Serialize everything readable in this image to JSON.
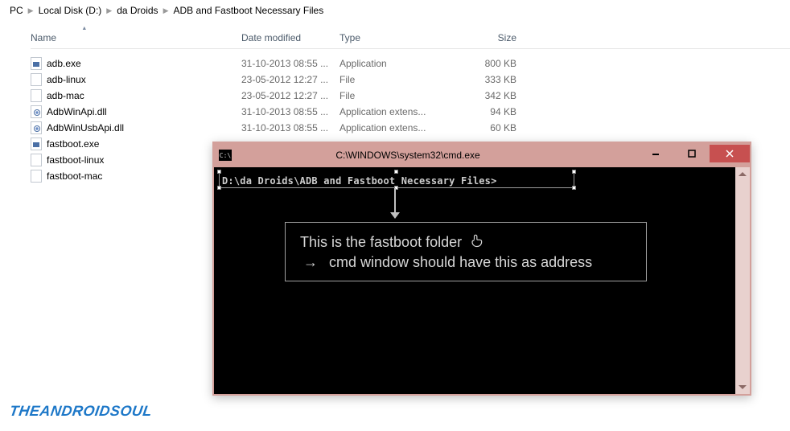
{
  "breadcrumb": {
    "segments": [
      "PC",
      "Local Disk (D:)",
      "da Droids",
      "ADB and Fastboot Necessary Files"
    ]
  },
  "columns": {
    "name": "Name",
    "date": "Date modified",
    "type": "Type",
    "size": "Size"
  },
  "files": [
    {
      "name": "adb.exe",
      "date": "31-10-2013 08:55 ...",
      "type": "Application",
      "size": "800 KB",
      "kind": "exe"
    },
    {
      "name": "adb-linux",
      "date": "23-05-2012 12:27 ...",
      "type": "File",
      "size": "333 KB",
      "kind": "plain"
    },
    {
      "name": "adb-mac",
      "date": "23-05-2012 12:27 ...",
      "type": "File",
      "size": "342 KB",
      "kind": "plain"
    },
    {
      "name": "AdbWinApi.dll",
      "date": "31-10-2013 08:55 ...",
      "type": "Application extens...",
      "size": "94 KB",
      "kind": "dll"
    },
    {
      "name": "AdbWinUsbApi.dll",
      "date": "31-10-2013 08:55 ...",
      "type": "Application extens...",
      "size": "60 KB",
      "kind": "dll"
    },
    {
      "name": "fastboot.exe",
      "date": "",
      "type": "",
      "size": "",
      "kind": "exe"
    },
    {
      "name": "fastboot-linux",
      "date": "",
      "type": "",
      "size": "",
      "kind": "plain"
    },
    {
      "name": "fastboot-mac",
      "date": "",
      "type": "",
      "size": "",
      "kind": "plain"
    }
  ],
  "cmd": {
    "title": "C:\\WINDOWS\\system32\\cmd.exe",
    "prompt": "D:\\da Droids\\ADB and Fastboot Necessary Files>"
  },
  "annotation": {
    "line1": "This is the fastboot folder",
    "line2": "cmd window should have this as address"
  },
  "watermark": "THEANDROIDSOUL"
}
